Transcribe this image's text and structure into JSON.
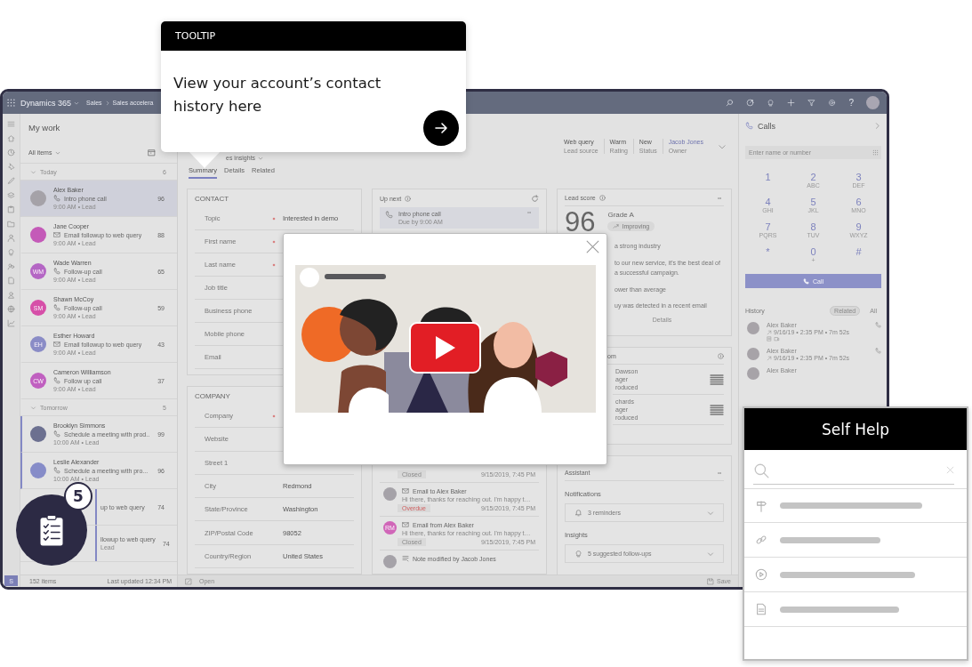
{
  "topbar": {
    "product": "Dynamics 365",
    "breadcrumb": [
      "Sales",
      "Sales accelera"
    ],
    "help": "?"
  },
  "rail": {
    "area": "S"
  },
  "work_panel": {
    "title": "My work",
    "filter": "All items",
    "groups": [
      {
        "label": "Today",
        "count": "6",
        "expanded": true,
        "items": [
          {
            "name": "Alex Baker",
            "kind": "call",
            "activity": "Intro phone call",
            "meta": "9:00 AM • Lead",
            "score": "96",
            "avatar": {
              "kind": "photo"
            },
            "selected": true,
            "highlighted": false
          },
          {
            "name": "Jane Cooper",
            "kind": "email",
            "activity": "Email followup to web query",
            "meta": "9:00 AM • Lead",
            "score": "88",
            "avatar": {
              "kind": "plain",
              "color": "#c45ab8"
            },
            "selected": false,
            "highlighted": false
          },
          {
            "name": "Wade Warren",
            "kind": "call",
            "activity": "Follow-up call",
            "meta": "9:00 AM • Lead",
            "score": "65",
            "avatar": {
              "kind": "initials",
              "initials": "WM",
              "color": "#b466c4"
            },
            "selected": false,
            "highlighted": false
          },
          {
            "name": "Shawn McCoy",
            "kind": "call",
            "activity": "Follow-up call",
            "meta": "9:00 AM • Lead",
            "score": "59",
            "avatar": {
              "kind": "initials",
              "initials": "SM",
              "color": "#d64fa8"
            },
            "selected": false,
            "highlighted": false
          },
          {
            "name": "Esther Howard",
            "kind": "email",
            "activity": "Email followup to web query",
            "meta": "9:00 AM • Lead",
            "score": "43",
            "avatar": {
              "kind": "initials",
              "initials": "EH",
              "color": "#8a8cc6"
            },
            "selected": false,
            "highlighted": false
          },
          {
            "name": "Cameron Williamson",
            "kind": "call",
            "activity": "Follow up call",
            "meta": "9:00 AM • Lead",
            "score": "37",
            "avatar": {
              "kind": "initials",
              "initials": "CW",
              "color": "#c060c0"
            },
            "selected": false,
            "highlighted": false
          }
        ]
      },
      {
        "label": "Tomorrow",
        "count": "5",
        "expanded": true,
        "items": [
          {
            "name": "Brooklyn Simmons",
            "kind": "call",
            "activity": "Schedule a meeting with prod..",
            "meta": "10:00 AM • Lead",
            "score": "99",
            "avatar": {
              "kind": "plain",
              "color": "#6c7090"
            },
            "selected": false,
            "highlighted": true
          },
          {
            "name": "Leslie Alexander",
            "kind": "call",
            "activity": "Schedule a meeting with pro...",
            "meta": "10:00 AM • Lead",
            "score": "96",
            "avatar": {
              "kind": "plain",
              "color": "#868cc8"
            },
            "selected": false,
            "highlighted": true
          },
          {
            "activity": "up to web query",
            "score": "74",
            "selected": false,
            "highlighted": true
          },
          {
            "activity": "llowup to web query",
            "meta": "Lead",
            "score": "74",
            "selected": false,
            "highlighted": true
          }
        ]
      }
    ],
    "footer_count": "152 items",
    "footer_updated": "Last updated 12:34 PM"
  },
  "record": {
    "view_menu": "es insights",
    "header_fields": [
      {
        "value": "Web query",
        "label": "Lead source",
        "link": false
      },
      {
        "value": "Warm",
        "label": "Rating",
        "link": false
      },
      {
        "value": "New",
        "label": "Status",
        "link": false
      },
      {
        "value": "Jacob Jones",
        "label": "Owner",
        "link": true
      }
    ],
    "tabs": [
      {
        "label": "Summary",
        "selected": true
      },
      {
        "label": "Details",
        "selected": false
      },
      {
        "label": "Related",
        "selected": false
      }
    ],
    "contact": {
      "title": "CONTACT",
      "fields": [
        {
          "label": "Topic",
          "required": true,
          "value": "Interested in demo"
        },
        {
          "label": "First name",
          "required": true
        },
        {
          "label": "Last name",
          "required": true
        },
        {
          "label": "Job title",
          "required": false
        },
        {
          "label": "Business phone",
          "required": false
        },
        {
          "label": "Mobile phone",
          "required": false
        },
        {
          "label": "Email",
          "required": false
        }
      ]
    },
    "company": {
      "title": "COMPANY",
      "fields": [
        {
          "label": "Company",
          "required": true
        },
        {
          "label": "Website",
          "required": false
        },
        {
          "label": "Street 1",
          "required": false
        },
        {
          "label": "City",
          "required": false,
          "value": "Redmond"
        },
        {
          "label": "State/Province",
          "required": false,
          "value": "Washington"
        },
        {
          "label": "ZIP/Postal Code",
          "required": false,
          "value": "98052"
        },
        {
          "label": "Country/Region",
          "required": false,
          "value": "United States"
        }
      ]
    },
    "up_next": {
      "title": "Up next",
      "task": {
        "title": "Intro phone call",
        "due": "Due by 9:00 AM"
      },
      "timeline": [
        {
          "kind": "tail",
          "tag": "Closed",
          "overdue": false,
          "date": "9/15/2019, 7:45 PM"
        },
        {
          "kind": "email",
          "avatar": {
            "kind": "photo"
          },
          "title": "Email to Alex Baker",
          "body": "Hi there, thanks for reaching out. I'm happy t…",
          "tag": "Overdue",
          "overdue": true,
          "date": "9/15/2019, 7:45 PM"
        },
        {
          "kind": "email",
          "avatar": {
            "kind": "initials",
            "initials": "RM",
            "color": "#d066b8"
          },
          "title": "Email from Alex Baker",
          "body": "Hi there, thanks for reaching out. I'm happy t…",
          "tag": "Closed",
          "overdue": false,
          "date": "9/15/2019, 7:45 PM"
        },
        {
          "kind": "note",
          "avatar": {
            "kind": "photo"
          },
          "title": "Note modified by Jacob Jones"
        }
      ]
    },
    "lead_score": {
      "title": "Lead score",
      "score": "96",
      "grade": "Grade A",
      "trend": "Improving",
      "reasons": [
        "a strong industry",
        "to our new service, it's the best deal of a successful campaign.",
        "ower than average",
        "uy was detected in a recent email"
      ],
      "details_link": "Details"
    },
    "who_knows": {
      "title": "om",
      "contacts": [
        {
          "name": "Dawson",
          "role": "ager",
          "status": "roduced"
        },
        {
          "name": "chards",
          "role": "ager",
          "status": "roduced"
        }
      ]
    },
    "assistant": {
      "title": "Assistant",
      "sections": [
        {
          "heading": "Notifications",
          "kind": "bell",
          "text": "3 reminders"
        },
        {
          "heading": "Insights",
          "kind": "bulb",
          "text": "5 suggested follow-ups"
        }
      ]
    },
    "status_bar": {
      "open": "Open",
      "save": "Save"
    }
  },
  "calls": {
    "title": "Calls",
    "placeholder": "Enter name or number",
    "keys": [
      {
        "digit": "1"
      },
      {
        "digit": "2",
        "letters": "ABC"
      },
      {
        "digit": "3",
        "letters": "DEF"
      },
      {
        "digit": "4",
        "letters": "GHI"
      },
      {
        "digit": "5",
        "letters": "JKL"
      },
      {
        "digit": "6",
        "letters": "MNO"
      },
      {
        "digit": "7",
        "letters": "PQRS"
      },
      {
        "digit": "8",
        "letters": "TUV"
      },
      {
        "digit": "9",
        "letters": "WXYZ"
      },
      {
        "digit": "*"
      },
      {
        "digit": "0",
        "letters": "+"
      },
      {
        "digit": "#"
      }
    ],
    "call_button": "Call",
    "history_title": "History",
    "filters": [
      {
        "label": "Related",
        "selected": true
      },
      {
        "label": "All",
        "selected": false
      }
    ],
    "history": [
      {
        "name": "Alex Baker",
        "detail": "9/16/19 • 2:35 PM • 7m 52s",
        "has_notes": true
      },
      {
        "name": "Alex Baker",
        "detail": "9/16/19 • 2:35 PM • 7m 52s",
        "has_notes": false
      },
      {
        "name": "Alex Baker",
        "has_notes": false
      }
    ]
  },
  "tooltip": {
    "label": "TOOLTIP",
    "text": "View your account’s contact history here"
  },
  "self_help": {
    "title": "Self Help",
    "items": [
      {
        "kind": "signpost"
      },
      {
        "kind": "link"
      },
      {
        "kind": "video"
      },
      {
        "kind": "document"
      }
    ]
  },
  "task_badge": {
    "count": "5"
  }
}
